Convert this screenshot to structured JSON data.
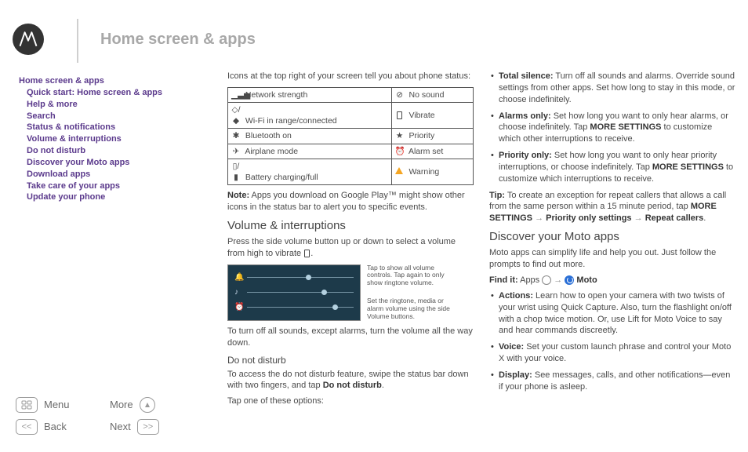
{
  "pageTitle": "Home screen & apps",
  "sidebar": {
    "top": "Home screen & apps",
    "items": [
      "Quick start: Home screen & apps",
      "Help & more",
      "Search",
      "Status & notifications",
      "Volume & interruptions",
      "Do not disturb",
      "Discover your Moto apps",
      "Download apps",
      "Take care of your apps",
      "Update your phone"
    ]
  },
  "nav": {
    "menu": "Menu",
    "back": "Back",
    "more": "More",
    "next": "Next"
  },
  "col1": {
    "intro": "Icons at the top right of your screen tell you about phone status:",
    "table": [
      {
        "l": "Network strength",
        "r": "No sound",
        "li": "▁▃▅",
        "ri": "⊘"
      },
      {
        "l": "Wi-Fi in range/connected",
        "r": "Vibrate",
        "li": "◇/◆",
        "ri": ""
      },
      {
        "l": "Bluetooth on",
        "r": "Priority",
        "li": "✱",
        "ri": "★"
      },
      {
        "l": "Airplane mode",
        "r": "Alarm set",
        "li": "✈",
        "ri": "⏰"
      },
      {
        "l": "Battery charging/full",
        "r": "Warning",
        "li": "▯/▮",
        "ri": ""
      }
    ],
    "noteLabel": "Note:",
    "note": " Apps you download on Google Play™ might show other icons in the status bar to alert you to specific events.",
    "h2": "Volume & interruptions",
    "volPara": "Press the side volume button up or down to select a volume from high to vibrate ",
    "cap1": "Tap to show all volume controls. Tap again to only show ringtone volume.",
    "cap2": "Set the ringtone, media or alarm volume using the side Volume buttons.",
    "turnOff": "To turn off all sounds, except alarms, turn the volume all the way down.",
    "h3": "Do not disturb",
    "dndPara1a": "To access the do not disturb feature, swipe the status bar down with two fingers, and tap ",
    "dndPara1b": "Do not disturb",
    "dndPara2": "Tap one of these options:"
  },
  "col2": {
    "bullets1": [
      {
        "b": "Total silence:",
        "t": " Turn off all sounds and alarms. Override sound settings from other apps. Set how long to stay in this mode, or choose indefinitely."
      },
      {
        "b": "Alarms only:",
        "t": " Set how long you want to only hear alarms, or choose indefinitely. Tap ",
        "b2": "MORE SETTINGS",
        "t2": " to customize which other interruptions to receive."
      },
      {
        "b": "Priority only:",
        "t": " Set how long you want to only hear priority interruptions, or choose indefinitely. Tap ",
        "b2": "MORE SETTINGS",
        "t2": " to customize which interruptions to receive."
      }
    ],
    "tipLabel": "Tip:",
    "tip1": " To create an exception for repeat callers that allows a call from the same person within a 15 minute period, tap ",
    "tipB1": "MORE SETTINGS",
    "tipArrow": " → ",
    "tipB2": "Priority only settings",
    "tipB3": "Repeat callers",
    "h2": "Discover your Moto apps",
    "discPara": "Moto apps can simplify life and help you out. Just follow the prompts to find out more.",
    "findLabel": "Find it:",
    "findApps": "  Apps ",
    "findMoto": " Moto",
    "bullets2": [
      {
        "b": "Actions:",
        "t": " Learn how to open your camera with two twists of your wrist using Quick Capture. Also, turn the flashlight on/off with a chop twice motion. Or, use Lift for Moto Voice to say and hear commands discreetly."
      },
      {
        "b": "Voice:",
        "t": " Set your custom launch phrase and control your Moto X with your voice."
      },
      {
        "b": "Display:",
        "t": " See messages, calls, and other notifications—even if your phone is asleep."
      }
    ]
  }
}
